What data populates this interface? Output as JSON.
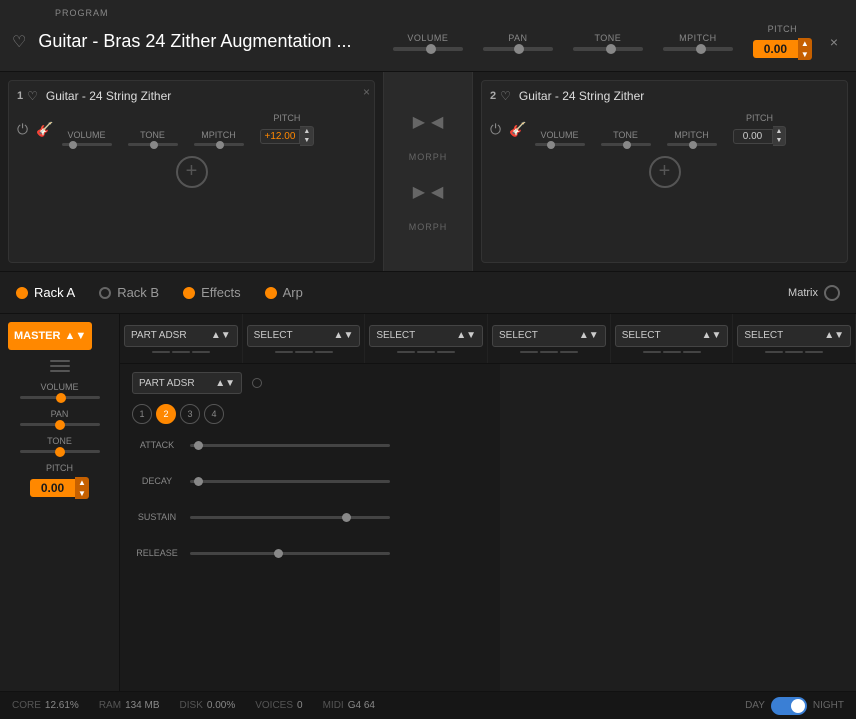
{
  "app": {
    "close_btn": "×"
  },
  "top_bar": {
    "program_label": "PROGRAM",
    "program_name": "Guitar - Bras 24 Zither Augmentation ...",
    "controls": [
      {
        "id": "volume",
        "label": "VOLUME",
        "thumb_pos": "50%"
      },
      {
        "id": "pan",
        "label": "PAN",
        "thumb_pos": "45%"
      },
      {
        "id": "tone",
        "label": "TONE",
        "thumb_pos": "50%"
      },
      {
        "id": "mpitch",
        "label": "MPITCH",
        "thumb_pos": "50%"
      }
    ],
    "pitch_label": "PITCH",
    "pitch_value": "0.00"
  },
  "layers": [
    {
      "num": "1",
      "name": "Guitar - 24 String Zither",
      "volume_thumb": "20%",
      "tone_thumb": "50%",
      "mpitch_thumb": "50%",
      "pitch_value": "+12.00"
    },
    {
      "num": "2",
      "name": "Guitar - 24 String Zither",
      "volume_thumb": "30%",
      "tone_thumb": "50%",
      "mpitch_thumb": "50%",
      "pitch_value": "0.00"
    }
  ],
  "morph": {
    "label": "MORPH"
  },
  "nav_tabs": [
    {
      "id": "rack-a",
      "label": "Rack A",
      "dot": "orange",
      "active": true
    },
    {
      "id": "rack-b",
      "label": "Rack B",
      "dot": "empty",
      "active": false
    },
    {
      "id": "effects",
      "label": "Effects",
      "dot": "orange",
      "active": false
    },
    {
      "id": "arp",
      "label": "Arp",
      "dot": "orange",
      "active": false
    }
  ],
  "matrix": {
    "label": "Matrix"
  },
  "left_panel": {
    "master_label": "MASTER",
    "volume_label": "VOLUME",
    "volume_thumb": "50%",
    "pan_label": "PAN",
    "pan_thumb": "50%",
    "tone_label": "TONE",
    "tone_thumb": "50%",
    "pitch_label": "PITCH",
    "pitch_value": "0.00"
  },
  "effects_row": {
    "slots": [
      {
        "label": "PART ADSR"
      },
      {
        "label": "SELECT"
      },
      {
        "label": "SELECT"
      },
      {
        "label": "SELECT"
      },
      {
        "label": "SELECT"
      },
      {
        "label": "SELECT"
      }
    ]
  },
  "adsr": {
    "part_label": "PART ADSR",
    "parts": [
      {
        "num": "1",
        "active": false
      },
      {
        "num": "2",
        "active": true
      },
      {
        "num": "3",
        "active": false
      },
      {
        "num": "4",
        "active": false
      }
    ],
    "rows": [
      {
        "id": "attack",
        "label": "ATTACK",
        "thumb_pos": "5%"
      },
      {
        "id": "decay",
        "label": "DECAY",
        "thumb_pos": "5%"
      },
      {
        "id": "sustain",
        "label": "SUSTAIN",
        "thumb_pos": "80%"
      },
      {
        "id": "release",
        "label": "RELEASE",
        "thumb_pos": "45%"
      }
    ]
  },
  "status_bar": {
    "items": [
      {
        "key": "CORE",
        "val": "12.61%"
      },
      {
        "key": "RAM",
        "val": "134 MB"
      },
      {
        "key": "DISK",
        "val": "0.00%"
      },
      {
        "key": "VOICES",
        "val": "0"
      },
      {
        "key": "MIDI",
        "val": "G4  64"
      }
    ],
    "day_label": "DAY",
    "night_label": "NIGHT"
  }
}
